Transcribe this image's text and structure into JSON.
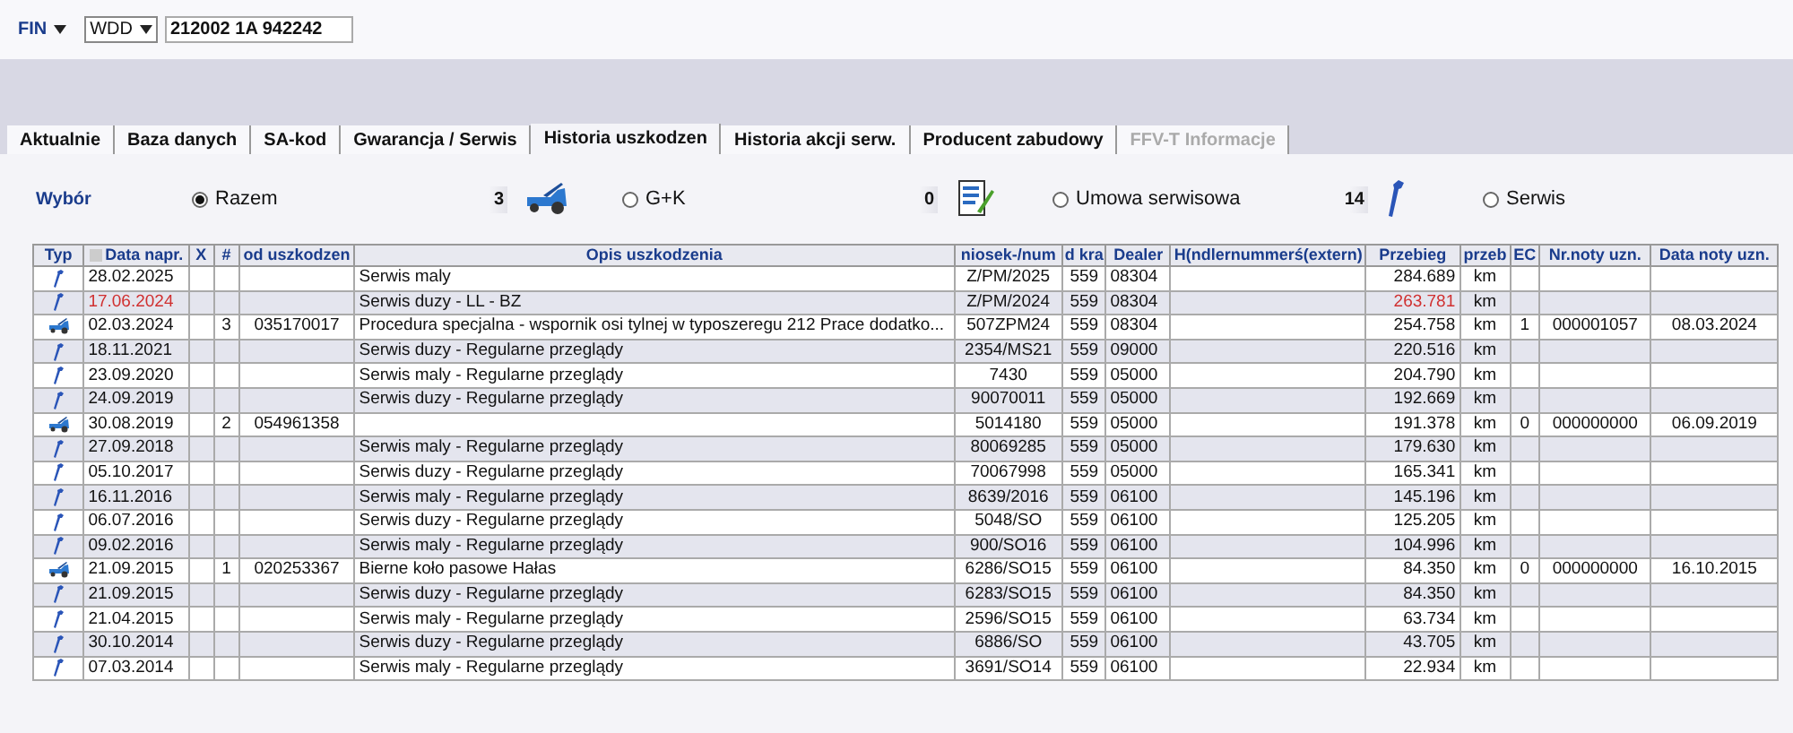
{
  "fin": {
    "label": "FIN",
    "prefix": "WDD",
    "value": "212002 1A 942242"
  },
  "tabs": [
    {
      "label": "Aktualnie",
      "selected": false,
      "disabled": false
    },
    {
      "label": "Baza danych",
      "selected": false,
      "disabled": false
    },
    {
      "label": "SA-kod",
      "selected": false,
      "disabled": false
    },
    {
      "label": "Gwarancja / Serwis",
      "selected": false,
      "disabled": false
    },
    {
      "label": "Historia uszkodzen",
      "selected": true,
      "disabled": false
    },
    {
      "label": "Historia akcji serw.",
      "selected": false,
      "disabled": false
    },
    {
      "label": "Producent zabudowy",
      "selected": false,
      "disabled": false
    },
    {
      "label": "FFV-T Informacje",
      "selected": false,
      "disabled": true
    }
  ],
  "filter": {
    "label": "Wybór",
    "items": [
      {
        "kind": "radio",
        "label": "Razem",
        "selected": true
      },
      {
        "kind": "counter",
        "count": "3"
      },
      {
        "kind": "radio",
        "label": "G+K",
        "selected": false
      },
      {
        "kind": "counter",
        "count": "0"
      },
      {
        "kind": "radio",
        "label": "Umowa serwisowa",
        "selected": false
      },
      {
        "kind": "counter",
        "count": "14"
      },
      {
        "kind": "radio",
        "label": "Serwis",
        "selected": false
      }
    ]
  },
  "table": {
    "columns": [
      "Typ",
      "Data napr.",
      "X",
      "#",
      "od uszkodzen",
      "Opis uszkodzenia",
      "niosek-/num",
      "d kra",
      "Dealer",
      "H(ndlernummerś(extern)",
      "Przebieg",
      "przeb",
      "EC",
      "Nr.noty uzn.",
      "Data noty uzn."
    ],
    "rows": [
      {
        "kind": "wrench",
        "highlighted": false,
        "date": "28.02.2025",
        "num": "",
        "code": "",
        "desc": "Serwis maly",
        "order": "Z/PM/2025",
        "country": "559",
        "dealer": "08304",
        "mileage": "284.689",
        "unit": "km",
        "ec": "",
        "note": "",
        "note_date": ""
      },
      {
        "kind": "wrench",
        "highlighted": true,
        "date": "17.06.2024",
        "num": "",
        "code": "",
        "desc": "Serwis duzy - LL - BZ",
        "order": "Z/PM/2024",
        "country": "559",
        "dealer": "08304",
        "mileage": "263.781",
        "unit": "km",
        "ec": "",
        "note": "",
        "note_date": ""
      },
      {
        "kind": "car",
        "highlighted": false,
        "date": "02.03.2024",
        "num": "3",
        "code": "035170017",
        "desc": "Procedura specjalna - wspornik osi tylnej w typoszeregu 212 Prace dodatko...",
        "order": "507ZPM24",
        "country": "559",
        "dealer": "08304",
        "mileage": "254.758",
        "unit": "km",
        "ec": "1",
        "note": "000001057",
        "note_date": "08.03.2024"
      },
      {
        "kind": "wrench",
        "highlighted": false,
        "date": "18.11.2021",
        "num": "",
        "code": "",
        "desc": "Serwis duzy - Regularne przeglądy",
        "order": "2354/MS21",
        "country": "559",
        "dealer": "09000",
        "mileage": "220.516",
        "unit": "km",
        "ec": "",
        "note": "",
        "note_date": ""
      },
      {
        "kind": "wrench",
        "highlighted": false,
        "date": "23.09.2020",
        "num": "",
        "code": "",
        "desc": "Serwis maly - Regularne przeglądy",
        "order": "7430",
        "country": "559",
        "dealer": "05000",
        "mileage": "204.790",
        "unit": "km",
        "ec": "",
        "note": "",
        "note_date": ""
      },
      {
        "kind": "wrench",
        "highlighted": false,
        "date": "24.09.2019",
        "num": "",
        "code": "",
        "desc": "Serwis duzy - Regularne przeglądy",
        "order": "90070011",
        "country": "559",
        "dealer": "05000",
        "mileage": "192.669",
        "unit": "km",
        "ec": "",
        "note": "",
        "note_date": ""
      },
      {
        "kind": "car",
        "highlighted": false,
        "date": "30.08.2019",
        "num": "2",
        "code": "054961358",
        "desc": "",
        "order": "5014180",
        "country": "559",
        "dealer": "05000",
        "mileage": "191.378",
        "unit": "km",
        "ec": "0",
        "note": "000000000",
        "note_date": "06.09.2019"
      },
      {
        "kind": "wrench",
        "highlighted": false,
        "date": "27.09.2018",
        "num": "",
        "code": "",
        "desc": "Serwis maly - Regularne przeglądy",
        "order": "80069285",
        "country": "559",
        "dealer": "05000",
        "mileage": "179.630",
        "unit": "km",
        "ec": "",
        "note": "",
        "note_date": ""
      },
      {
        "kind": "wrench",
        "highlighted": false,
        "date": "05.10.2017",
        "num": "",
        "code": "",
        "desc": "Serwis duzy - Regularne przeglądy",
        "order": "70067998",
        "country": "559",
        "dealer": "05000",
        "mileage": "165.341",
        "unit": "km",
        "ec": "",
        "note": "",
        "note_date": ""
      },
      {
        "kind": "wrench",
        "highlighted": false,
        "date": "16.11.2016",
        "num": "",
        "code": "",
        "desc": "Serwis maly - Regularne przeglądy",
        "order": "8639/2016",
        "country": "559",
        "dealer": "06100",
        "mileage": "145.196",
        "unit": "km",
        "ec": "",
        "note": "",
        "note_date": ""
      },
      {
        "kind": "wrench",
        "highlighted": false,
        "date": "06.07.2016",
        "num": "",
        "code": "",
        "desc": "Serwis duzy - Regularne przeglądy",
        "order": "5048/SO",
        "country": "559",
        "dealer": "06100",
        "mileage": "125.205",
        "unit": "km",
        "ec": "",
        "note": "",
        "note_date": ""
      },
      {
        "kind": "wrench",
        "highlighted": false,
        "date": "09.02.2016",
        "num": "",
        "code": "",
        "desc": "Serwis maly - Regularne przeglądy",
        "order": "900/SO16",
        "country": "559",
        "dealer": "06100",
        "mileage": "104.996",
        "unit": "km",
        "ec": "",
        "note": "",
        "note_date": ""
      },
      {
        "kind": "car",
        "highlighted": false,
        "date": "21.09.2015",
        "num": "1",
        "code": "020253367",
        "desc": "Bierne koło pasowe Hałas",
        "order": "6286/SO15",
        "country": "559",
        "dealer": "06100",
        "mileage": "84.350",
        "unit": "km",
        "ec": "0",
        "note": "000000000",
        "note_date": "16.10.2015"
      },
      {
        "kind": "wrench",
        "highlighted": false,
        "date": "21.09.2015",
        "num": "",
        "code": "",
        "desc": "Serwis duzy - Regularne przeglądy",
        "order": "6283/SO15",
        "country": "559",
        "dealer": "06100",
        "mileage": "84.350",
        "unit": "km",
        "ec": "",
        "note": "",
        "note_date": ""
      },
      {
        "kind": "wrench",
        "highlighted": false,
        "date": "21.04.2015",
        "num": "",
        "code": "",
        "desc": "Serwis maly - Regularne przeglądy",
        "order": "2596/SO15",
        "country": "559",
        "dealer": "06100",
        "mileage": "63.734",
        "unit": "km",
        "ec": "",
        "note": "",
        "note_date": ""
      },
      {
        "kind": "wrench",
        "highlighted": false,
        "date": "30.10.2014",
        "num": "",
        "code": "",
        "desc": "Serwis duzy - Regularne przeglądy",
        "order": "6886/SO",
        "country": "559",
        "dealer": "06100",
        "mileage": "43.705",
        "unit": "km",
        "ec": "",
        "note": "",
        "note_date": ""
      },
      {
        "kind": "wrench",
        "highlighted": false,
        "date": "07.03.2014",
        "num": "",
        "code": "",
        "desc": "Serwis maly - Regularne przeglądy",
        "order": "3691/SO14",
        "country": "559",
        "dealer": "06100",
        "mileage": "22.934",
        "unit": "km",
        "ec": "",
        "note": "",
        "note_date": ""
      }
    ]
  }
}
